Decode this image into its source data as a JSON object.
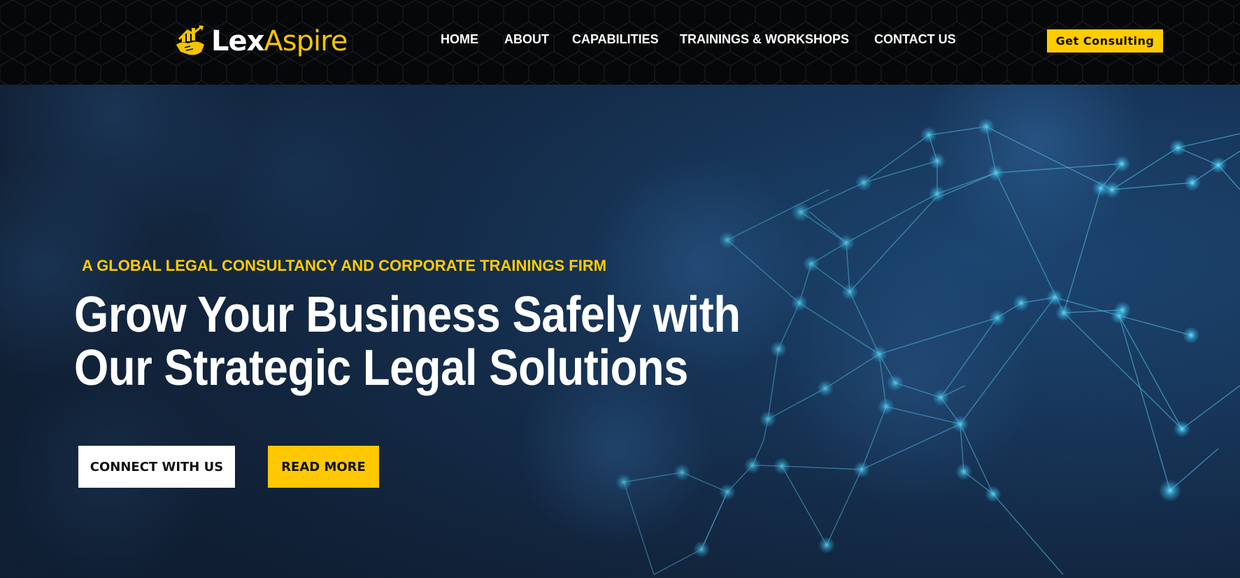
{
  "brand": {
    "name_part1": "Lex",
    "name_part2": "Aspire",
    "logo_icon": "handshake-chart-icon",
    "accent_color": "#ffcc00"
  },
  "nav": {
    "items": [
      {
        "label": "HOME"
      },
      {
        "label": "ABOUT"
      },
      {
        "label": "CAPABILITIES"
      },
      {
        "label": "TRAININGS & WORKSHOPS"
      },
      {
        "label": "CONTACT US"
      }
    ],
    "cta_label": "Get Consulting"
  },
  "hero": {
    "tagline": "A GLOBAL LEGAL CONSULTANCY AND CORPORATE TRAININGS FIRM",
    "headline_line1": "Grow Your Business Safely with",
    "headline_line2": "Our Strategic Legal Solutions",
    "primary_button": "CONNECT WITH US",
    "secondary_button": "READ MORE",
    "background": "network-globe-image"
  }
}
